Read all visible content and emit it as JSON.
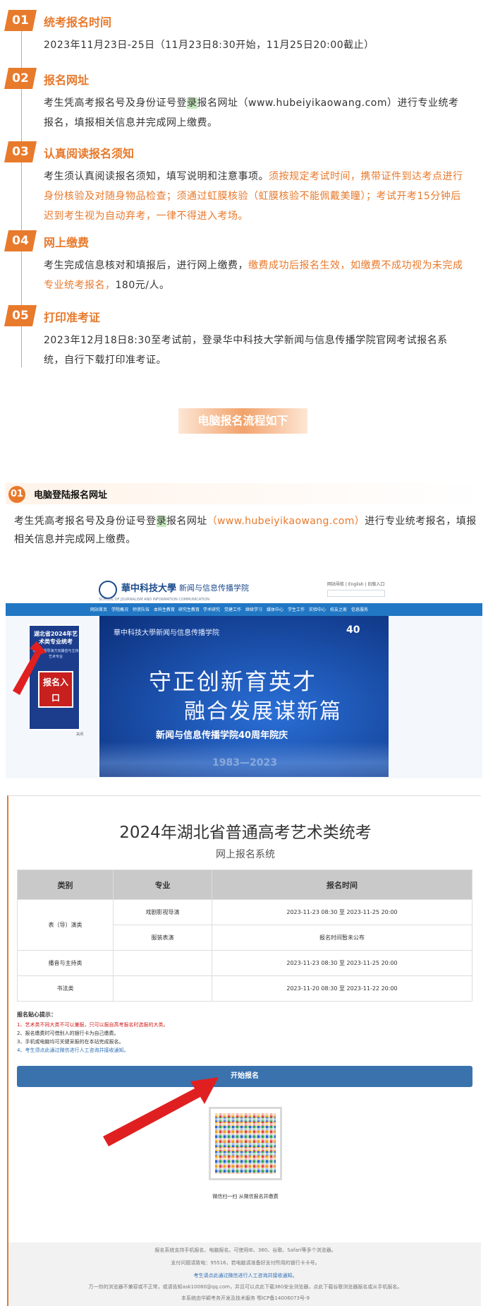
{
  "steps": [
    {
      "num": "01",
      "title": "统考报名时间",
      "lines": [
        "2023年11月23日-25日（11月23日8:30开始，11月25日20:00截止）"
      ]
    },
    {
      "num": "02",
      "title": "报名网址",
      "text_a": "考生凭高考报名号及身份证号登",
      "text_mark": "录",
      "text_b": "报名网址（www.hubeiyikaowang.com）进行专业统考报名，填报相关信息并完成网上缴费。"
    },
    {
      "num": "03",
      "title": "认真阅读报名须知",
      "text_plain": "考生须认真阅读报名须知，填写说明和注意事项。",
      "text_hl": "须按规定考试时间，携带证件到达考点进行身份核验及对随身物品检查；须通过虹膜核验（虹膜核验不能佩戴美瞳）；考试开考15分钟后迟到考生视为自动弃考，一律不得进入考场。"
    },
    {
      "num": "04",
      "title": "网上缴费",
      "text_plain": "考生完成信息核对和填报后，进行网上缴费，",
      "text_hl": "缴费成功后报名生效，如缴费不成功视为未完成专业统考报名，",
      "text_end": "180元/人。"
    },
    {
      "num": "05",
      "title": "打印准考证",
      "text_plain": "2023年12月18日8:30至考试前，登录华中科技大学新闻与信息传播学院官网考试报名系统，自行下载打印准考证。"
    }
  ],
  "banner": {
    "label": "电脑报名流程如下"
  },
  "sub_section": {
    "num": "01",
    "title": "电脑登陆报名网址",
    "text_a": "考生凭高考报名号及身份证号登",
    "text_mark": "录",
    "text_b": "报名网址",
    "url": "（www.hubeiyikaowang.com）",
    "text_c": "进行专业统考报名，填报相关信息并完成网上缴费。"
  },
  "website": {
    "school_name": "華中科技大學",
    "dept_name": "新闻与信息传播学院",
    "en_name": "SCHOOL OF JOURNALISM AND INFORMATION COMMUNICATION",
    "top_links": "网站导航 | English | 旧版入口",
    "nav_items": [
      "网站首页",
      "学院概况",
      "师资队伍",
      "本科生教育",
      "研究生教育",
      "学术研究",
      "党建工作",
      "继续学习",
      "媒体中心",
      "学生工作",
      "实验中心",
      "校友之家",
      "信息服务"
    ],
    "hero_logo": "華中科技大學新闻与信息传播学院",
    "hero_40": "40",
    "hero_line1": "守正创新育英才",
    "hero_line2": "融合发展谋新篇",
    "hero_sub": "新闻与信息传播学院40周年院庆",
    "hero_years": "1983—2023",
    "side_ad_title": "湖北省2024年艺术类专业统考",
    "side_ad_sub": "戏剧影视导演方向播音与主持艺术专业",
    "side_ad_enter": "报名入口",
    "side_close": "关闭"
  },
  "register": {
    "title": "2024年湖北省普通高考艺术类统考",
    "subtitle": "网上报名系统",
    "headers": [
      "类别",
      "专业",
      "报名时间"
    ],
    "rows": [
      {
        "cat": "表（导）演类",
        "major": "戏剧影视导演",
        "time": "2023-11-23 08:30 至 2023-11-25 20:00"
      },
      {
        "cat": "",
        "major": "服装表演",
        "time": "报名时间暂未公布"
      },
      {
        "cat": "播音与主持类",
        "major": "",
        "time": "2023-11-23 08:30 至 2023-11-25 20:00"
      },
      {
        "cat": "书法类",
        "major": "",
        "time": "2023-11-20 08:30 至 2023-11-22 20:00"
      }
    ],
    "tips_title": "报名贴心提示：",
    "tips": [
      {
        "text": "1、艺术类不同大类不可以兼报，只可以报自高考报名时选报的大类。",
        "tone": "red"
      },
      {
        "text": "2、报名缴费时可借别人的银行卡为自己缴费。",
        "tone": "dark"
      },
      {
        "text": "3、手机或电脑均可关键采报的在本站完成报名。",
        "tone": "dark"
      },
      {
        "text": "4、考生须点此通过微信进行人工咨询并接收通知。",
        "tone": "blue"
      }
    ],
    "start_button": "开始报名",
    "qr_caption": "微信扫一扫 从微信报名并缴费",
    "footer_lines": [
      "报名系统支持手机报名、电脑报名。可使用IE、360、谷歌、Safari等多个浏览器。",
      "支付问题请致电：95516，若电脑请准备好支付所用的银行卡卡号。",
      "考生请点此通过微信进行人工咨询并接收通知。",
      "万一你的浏览器不兼容或不正常，或请告知ask10080@qq.com，并且可以点此下载360安全浏览器，点此下载谷歌浏览器报名或从手机报名。",
      "本系统由华颖考务开发及技术服务 鄂ICP备14006073号-9"
    ]
  }
}
